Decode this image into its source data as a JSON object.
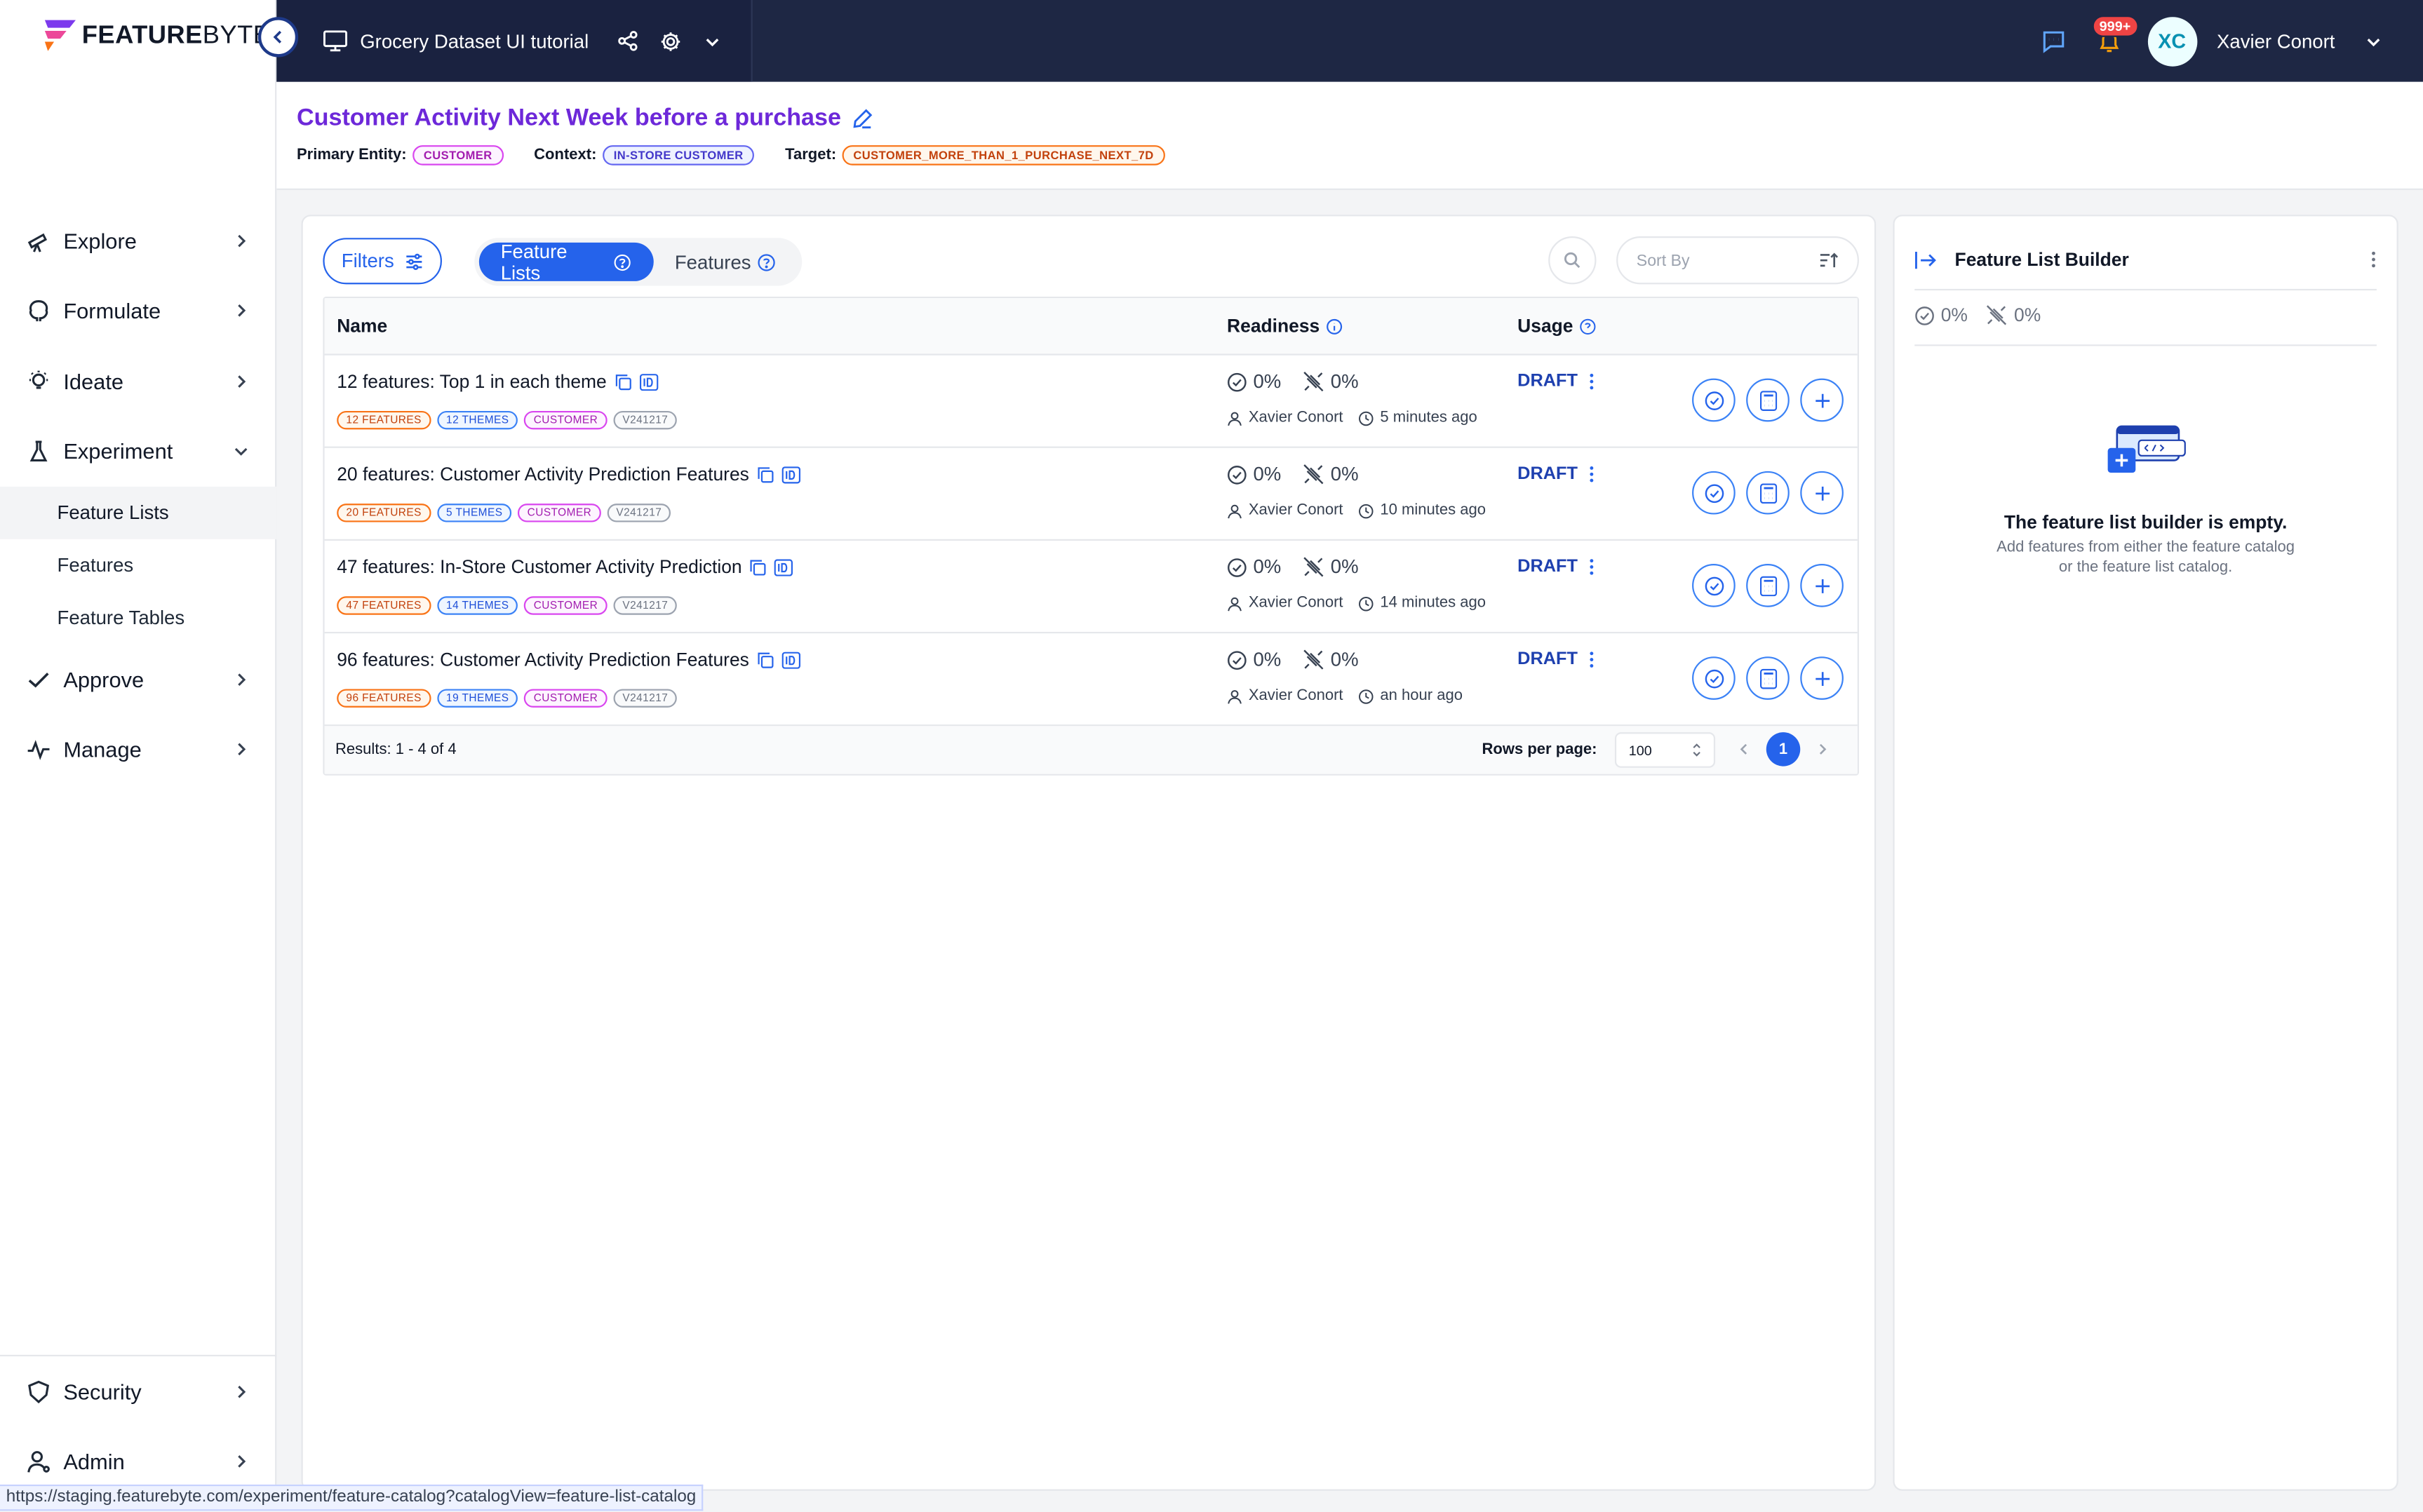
{
  "brand": {
    "part1": "FEATURE",
    "part2": "BYTE",
    "colors": {
      "accent": "#2563eb",
      "purple": "#6d28d9",
      "navy": "#1e2744"
    }
  },
  "topbar": {
    "dataset_title": "Grocery Dataset UI tutorial",
    "notification_count": "999+",
    "user_initials": "XC",
    "user_name": "Xavier Conort"
  },
  "sidebar": {
    "items": [
      {
        "label": "Explore",
        "icon": "telescope-icon"
      },
      {
        "label": "Formulate",
        "icon": "brain-icon"
      },
      {
        "label": "Ideate",
        "icon": "lightbulb-icon"
      },
      {
        "label": "Experiment",
        "icon": "flask-icon",
        "expanded": true
      }
    ],
    "sub_items": [
      "Feature Lists",
      "Features",
      "Feature Tables"
    ],
    "items_after": [
      {
        "label": "Approve",
        "icon": "check-icon"
      },
      {
        "label": "Manage",
        "icon": "pulse-icon"
      }
    ],
    "bottom": [
      {
        "label": "Security",
        "icon": "shield-icon"
      },
      {
        "label": "Admin",
        "icon": "user-icon"
      }
    ]
  },
  "header": {
    "title": "Customer Activity Next Week before a purchase",
    "primary_entity_label": "Primary Entity:",
    "primary_entity": "CUSTOMER",
    "context_label": "Context:",
    "context": "IN-STORE CUSTOMER",
    "target_label": "Target:",
    "target": "CUSTOMER_MORE_THAN_1_PURCHASE_NEXT_7D"
  },
  "toolbar": {
    "filters_label": "Filters",
    "tab_feature_lists": "Feature Lists",
    "tab_features": "Features",
    "sort_placeholder": "Sort By"
  },
  "table": {
    "col_name": "Name",
    "col_readiness": "Readiness",
    "col_usage": "Usage",
    "rows": [
      {
        "name": "12 features: Top 1 in each theme",
        "tags": [
          "12 FEATURES",
          "12 THEMES",
          "CUSTOMER",
          "V241217"
        ],
        "ready": "0%",
        "online": "0%",
        "owner": "Xavier Conort",
        "time": "5 minutes ago",
        "status": "DRAFT"
      },
      {
        "name": "20 features: Customer Activity Prediction Features",
        "tags": [
          "20 FEATURES",
          "5 THEMES",
          "CUSTOMER",
          "V241217"
        ],
        "ready": "0%",
        "online": "0%",
        "owner": "Xavier Conort",
        "time": "10 minutes ago",
        "status": "DRAFT"
      },
      {
        "name": "47 features: In-Store Customer Activity Prediction",
        "tags": [
          "47 FEATURES",
          "14 THEMES",
          "CUSTOMER",
          "V241217"
        ],
        "ready": "0%",
        "online": "0%",
        "owner": "Xavier Conort",
        "time": "14 minutes ago",
        "status": "DRAFT"
      },
      {
        "name": "96 features: Customer Activity Prediction Features",
        "tags": [
          "96 FEATURES",
          "19 THEMES",
          "CUSTOMER",
          "V241217"
        ],
        "ready": "0%",
        "online": "0%",
        "owner": "Xavier Conort",
        "time": "an hour ago",
        "status": "DRAFT"
      }
    ],
    "results": "Results: 1 - 4 of 4",
    "rows_per_page_label": "Rows per page:",
    "rows_per_page": "100",
    "page": "1"
  },
  "builder": {
    "title": "Feature List Builder",
    "ready": "0%",
    "online": "0%",
    "empty_title": "The feature list builder is empty.",
    "empty_desc_1": "Add features from either the feature catalog",
    "empty_desc_2": "or the feature list catalog."
  },
  "statusbar": {
    "url": "https://staging.featurebyte.com/experiment/feature-catalog?catalogView=feature-list-catalog"
  }
}
